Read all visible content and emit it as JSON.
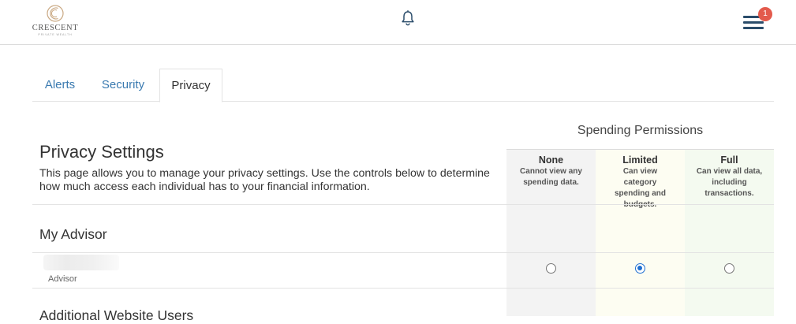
{
  "header": {
    "logo": {
      "name": "CRESCENT",
      "sub": "PRIVATE WEALTH"
    },
    "notifications_icon": "bell-icon",
    "menu_icon": "hamburger-menu-icon",
    "menu_badge": "1"
  },
  "tabs": [
    {
      "label": "Alerts",
      "active": false
    },
    {
      "label": "Security",
      "active": false
    },
    {
      "label": "Privacy",
      "active": true
    }
  ],
  "privacy": {
    "title": "Privacy Settings",
    "description": "This page allows you to manage your privacy settings.  Use the controls below to determine how much access each individual has to your financial information."
  },
  "permissions": {
    "title": "Spending Permissions",
    "columns": [
      {
        "name": "None",
        "description": "Cannot view any spending data."
      },
      {
        "name": "Limited",
        "description": "Can view category spending and budgets."
      },
      {
        "name": "Full",
        "description": "Can view all data, including transactions."
      }
    ]
  },
  "sections": {
    "advisor_title": "My Advisor",
    "users_title": "Additional Website Users"
  },
  "advisor": {
    "name": "",
    "role": "Advisor",
    "selected_permission": "Limited"
  },
  "colors": {
    "link": "#3a7ab0",
    "badge": "#e35a4c",
    "radio_selected": "#1f6fd1",
    "menu": "#2b4d6b"
  }
}
